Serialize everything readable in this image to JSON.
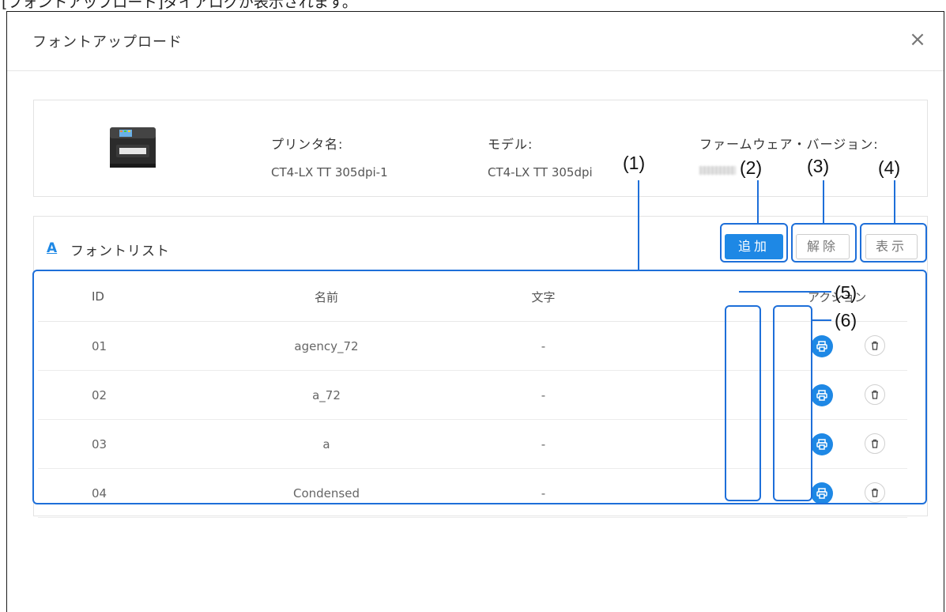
{
  "caption": "[フォントアップロード]ダイアログが表示されます。",
  "dialog": {
    "title": "フォントアップロード",
    "close": "×"
  },
  "printer": {
    "name_label": "プリンタ名:",
    "name_value": "CT4-LX TT 305dpi-1",
    "model_label": "モデル:",
    "model_value": "CT4-LX TT 305dpi",
    "firmware_label": "ファームウェア・バージョン:"
  },
  "font_list": {
    "icon": "A",
    "title": "フォントリスト",
    "add_label": "追加",
    "release_label": "解除",
    "show_label": "表示",
    "columns": [
      "ID",
      "名前",
      "文字",
      "アクション"
    ],
    "rows": [
      {
        "id": "01",
        "name": "agency_72",
        "chars": "-"
      },
      {
        "id": "02",
        "name": "a_72",
        "chars": "-"
      },
      {
        "id": "03",
        "name": "a",
        "chars": "-"
      },
      {
        "id": "04",
        "name": "Condensed",
        "chars": "-"
      }
    ]
  },
  "annotations": {
    "m1": "(1)",
    "m2": "(2)",
    "m3": "(3)",
    "m4": "(4)",
    "m5": "(5)",
    "m6": "(6)",
    "highlight_color": "#1e6fd9"
  },
  "icons": [
    "close-icon",
    "printer-image",
    "font-a-icon",
    "print-icon",
    "trash-icon"
  ],
  "colors": {
    "accent": "#1e88e5"
  }
}
